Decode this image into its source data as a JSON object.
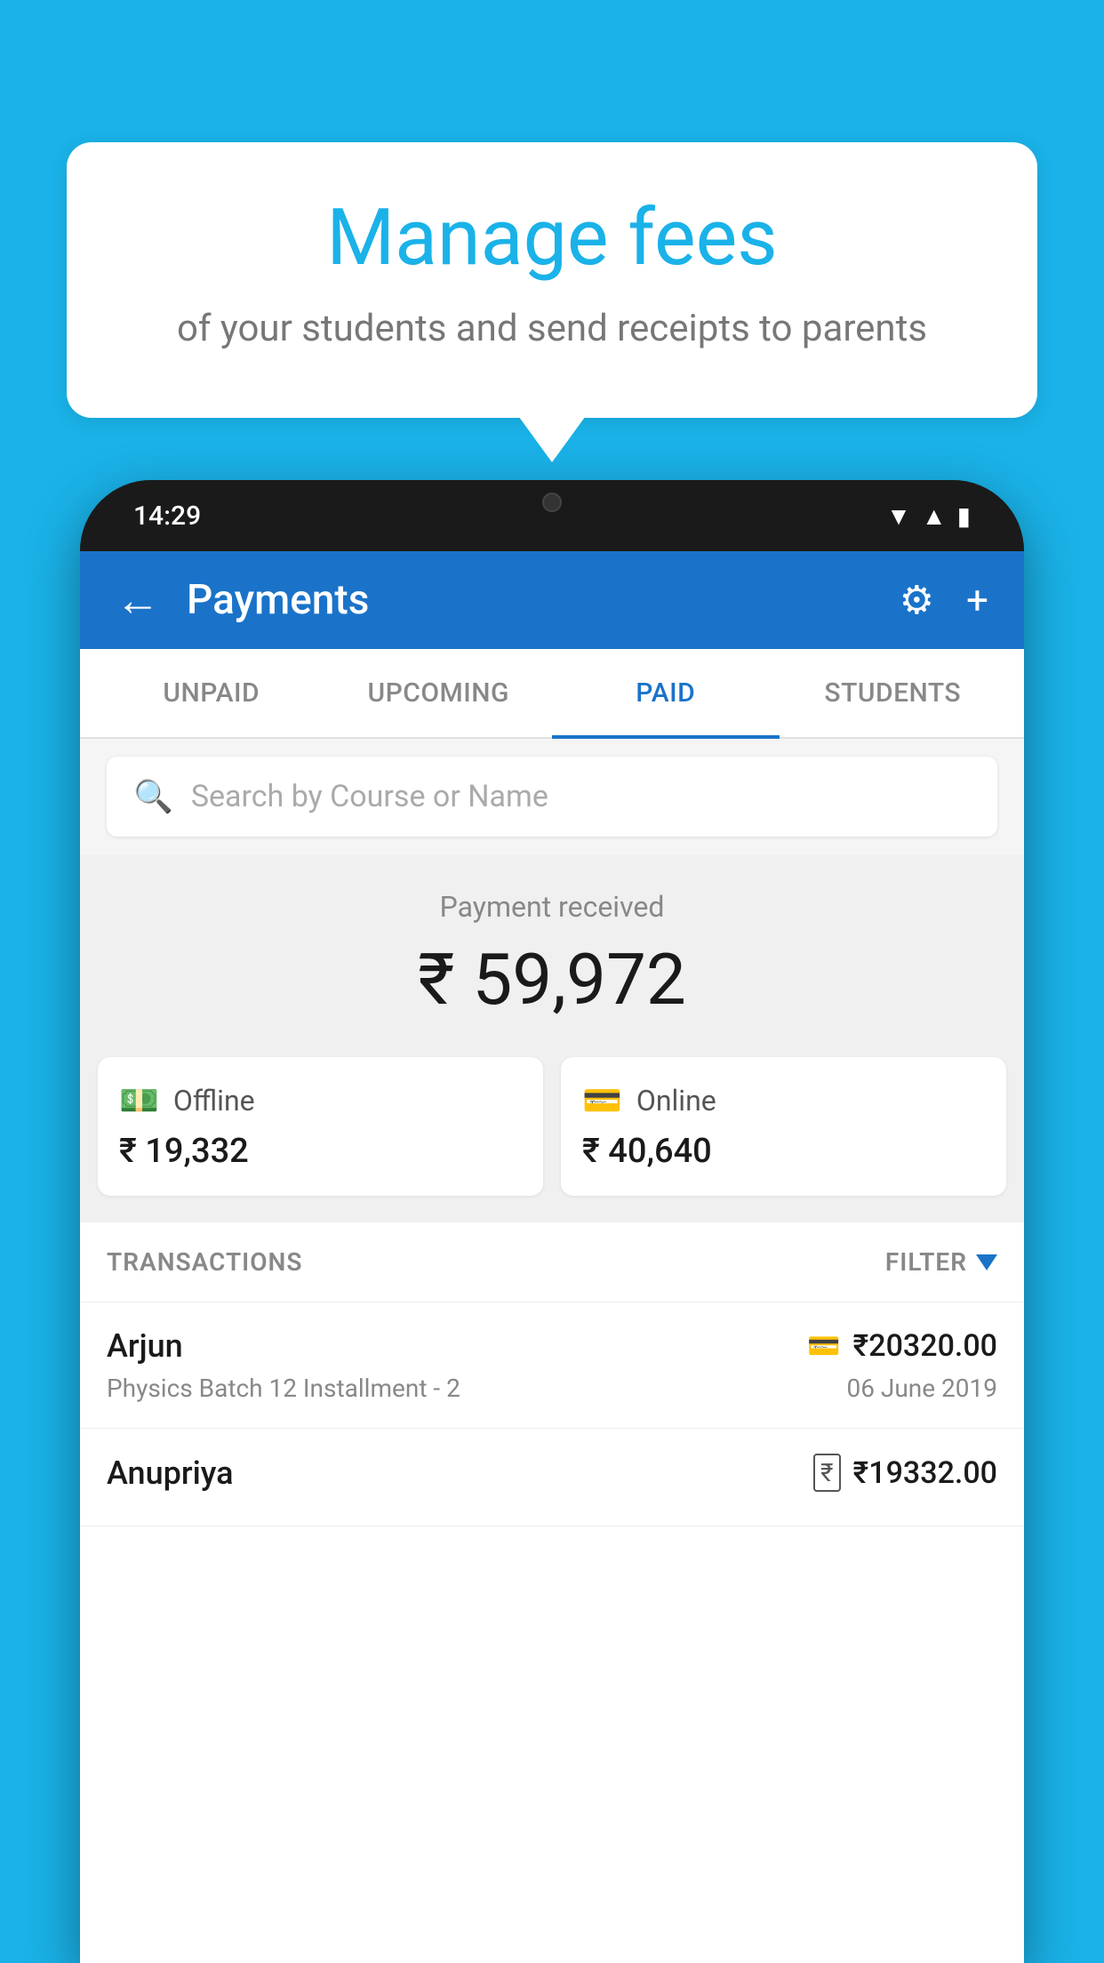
{
  "page": {
    "background_color": "#1ab2e8"
  },
  "bubble": {
    "title": "Manage fees",
    "subtitle": "of your students and send receipts to parents"
  },
  "phone": {
    "status_bar": {
      "time": "14:29"
    },
    "header": {
      "back_icon": "←",
      "title": "Payments",
      "settings_icon": "⚙",
      "add_icon": "+"
    },
    "tabs": [
      {
        "label": "UNPAID",
        "active": false
      },
      {
        "label": "UPCOMING",
        "active": false
      },
      {
        "label": "PAID",
        "active": true
      },
      {
        "label": "STUDENTS",
        "active": false
      }
    ],
    "search": {
      "placeholder": "Search by Course or Name"
    },
    "payment_received": {
      "label": "Payment received",
      "amount": "₹ 59,972",
      "offline": {
        "label": "Offline",
        "amount": "₹ 19,332"
      },
      "online": {
        "label": "Online",
        "amount": "₹ 40,640"
      }
    },
    "transactions": {
      "label": "TRANSACTIONS",
      "filter_label": "FILTER",
      "rows": [
        {
          "name": "Arjun",
          "payment_type": "card",
          "amount": "₹20320.00",
          "course": "Physics Batch 12 Installment - 2",
          "date": "06 June 2019"
        },
        {
          "name": "Anupriya",
          "payment_type": "cash",
          "amount": "₹19332.00",
          "course": "",
          "date": ""
        }
      ]
    }
  }
}
